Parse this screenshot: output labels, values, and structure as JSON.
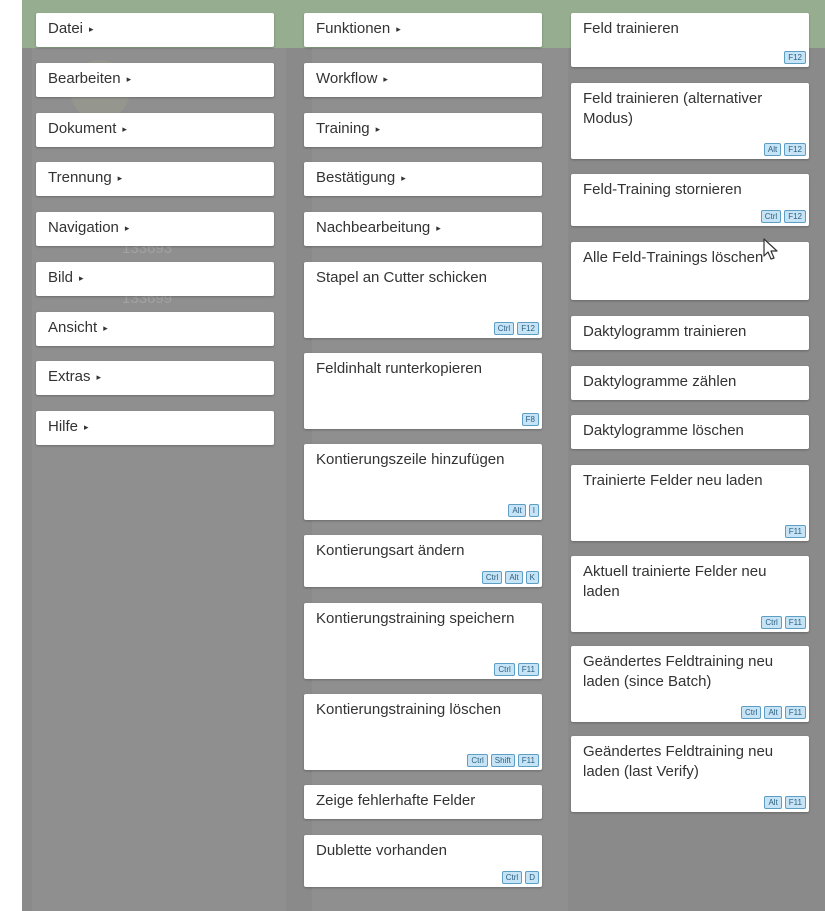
{
  "menu": {
    "main": [
      {
        "label": "Datei",
        "submenu": true
      },
      {
        "label": "Bearbeiten",
        "submenu": true
      },
      {
        "label": "Dokument",
        "submenu": true
      },
      {
        "label": "Trennung",
        "submenu": true
      },
      {
        "label": "Navigation",
        "submenu": true
      },
      {
        "label": "Bild",
        "submenu": true
      },
      {
        "label": "Ansicht",
        "submenu": true
      },
      {
        "label": "Extras",
        "submenu": true
      },
      {
        "label": "Hilfe",
        "submenu": true
      }
    ],
    "extras": [
      {
        "label": "Funktionen",
        "submenu": true
      },
      {
        "label": "Workflow",
        "submenu": true
      },
      {
        "label": "Training",
        "submenu": true
      },
      {
        "label": "Bestätigung",
        "submenu": true
      },
      {
        "label": "Nachbearbeitung",
        "submenu": true
      },
      {
        "label": "Stapel an Cutter schicken",
        "shortcut": [
          "Ctrl",
          "F12"
        ]
      },
      {
        "label": "Feldinhalt runterkopieren",
        "shortcut": [
          "F8"
        ]
      },
      {
        "label": "Kontierungszeile hinzufügen",
        "shortcut": [
          "Alt",
          "I"
        ]
      },
      {
        "label": "Kontierungsart ändern",
        "shortcut": [
          "Ctrl",
          "Alt",
          "K"
        ]
      },
      {
        "label": "Kontierungstraining speichern",
        "shortcut": [
          "Ctrl",
          "F11"
        ]
      },
      {
        "label": "Kontierungstraining löschen",
        "shortcut": [
          "Ctrl",
          "Shift",
          "F11"
        ]
      },
      {
        "label": "Zeige fehlerhafte Felder"
      },
      {
        "label": "Dublette vorhanden",
        "shortcut": [
          "Ctrl",
          "D"
        ]
      }
    ],
    "training": [
      {
        "label": "Feld trainieren",
        "shortcut": [
          "F12"
        ]
      },
      {
        "label": "Feld trainieren (alternativer Modus)",
        "shortcut": [
          "Alt",
          "F12"
        ]
      },
      {
        "label": "Feld-Training stornieren",
        "shortcut": [
          "Ctrl",
          "F12"
        ]
      },
      {
        "label": "Alle Feld-Trainings löschen"
      },
      {
        "label": "Daktylogramm trainieren"
      },
      {
        "label": "Daktylogramme zählen"
      },
      {
        "label": "Daktylogramme löschen"
      },
      {
        "label": "Trainierte Felder neu laden",
        "shortcut": [
          "F11"
        ]
      },
      {
        "label": "Aktuell trainierte Felder neu laden",
        "shortcut": [
          "Ctrl",
          "F11"
        ]
      },
      {
        "label": "Geändertes Feldtraining neu laden (since Batch)",
        "shortcut": [
          "Ctrl",
          "Alt",
          "F11"
        ]
      },
      {
        "label": "Geändertes Feldtraining neu laden (last Verify)",
        "shortcut": [
          "Alt",
          "F11"
        ]
      }
    ]
  },
  "background": {
    "numbers": [
      "133693",
      "133699"
    ]
  }
}
